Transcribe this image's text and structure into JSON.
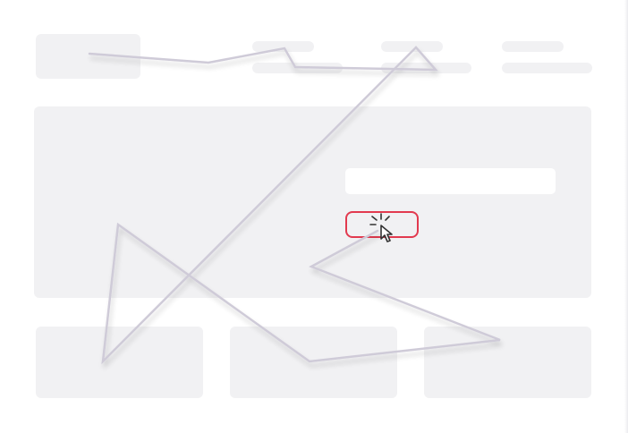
{
  "illustration": {
    "kind": "wireframe-mouse-trajectory",
    "icons": [
      "cursor-click-icon"
    ],
    "colors": {
      "placeholder": "#f1f1f3",
      "path": "#cfcbd8",
      "highlight": "#e23a4f",
      "cursor": "#333333"
    }
  }
}
